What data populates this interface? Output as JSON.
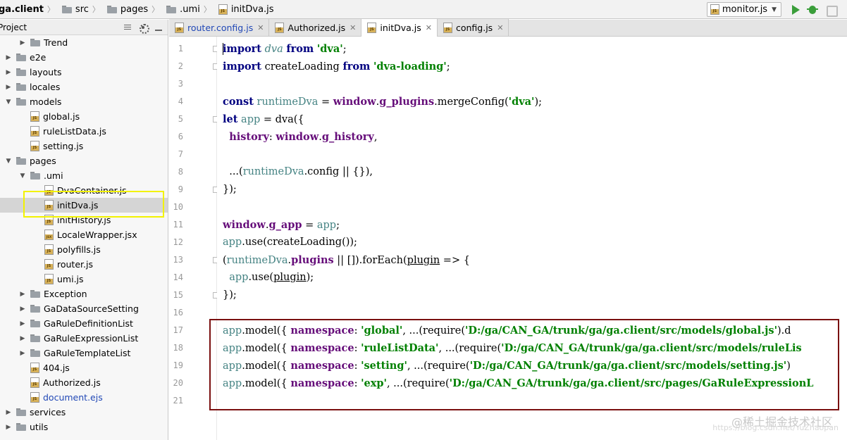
{
  "breadcrumb": [
    {
      "label": "ga.client",
      "icon": "folder-icon"
    },
    {
      "label": "src",
      "icon": "folder-icon"
    },
    {
      "label": "pages",
      "icon": "folder-icon"
    },
    {
      "label": ".umi",
      "icon": "folder-icon"
    },
    {
      "label": "initDva.js",
      "icon": "js-file-icon"
    }
  ],
  "run": {
    "config_label": "monitor.js"
  },
  "project_panel": {
    "title": "Project"
  },
  "tree": [
    {
      "label": "Trend",
      "type": "folder",
      "depth": 1,
      "arrow": "▶"
    },
    {
      "label": "e2e",
      "type": "folder",
      "depth": 0,
      "arrow": "▶"
    },
    {
      "label": "layouts",
      "type": "folder",
      "depth": 0,
      "arrow": "▶"
    },
    {
      "label": "locales",
      "type": "folder",
      "depth": 0,
      "arrow": "▶"
    },
    {
      "label": "models",
      "type": "folder",
      "depth": 0,
      "arrow": "▼"
    },
    {
      "label": "global.js",
      "type": "js",
      "depth": 1
    },
    {
      "label": "ruleListData.js",
      "type": "js",
      "depth": 1
    },
    {
      "label": "setting.js",
      "type": "js",
      "depth": 1
    },
    {
      "label": "pages",
      "type": "folder",
      "depth": 0,
      "arrow": "▼"
    },
    {
      "label": ".umi",
      "type": "folder",
      "depth": 1,
      "arrow": "▼"
    },
    {
      "label": "DvaContainer.js",
      "type": "js",
      "depth": 2
    },
    {
      "label": "initDva.js",
      "type": "js",
      "depth": 2,
      "selected": true
    },
    {
      "label": "initHistory.js",
      "type": "js",
      "depth": 2
    },
    {
      "label": "LocaleWrapper.jsx",
      "type": "jsx",
      "depth": 2
    },
    {
      "label": "polyfills.js",
      "type": "js",
      "depth": 2
    },
    {
      "label": "router.js",
      "type": "js",
      "depth": 2
    },
    {
      "label": "umi.js",
      "type": "js",
      "depth": 2
    },
    {
      "label": "Exception",
      "type": "folder",
      "depth": 1,
      "arrow": "▶"
    },
    {
      "label": "GaDataSourceSetting",
      "type": "folder",
      "depth": 1,
      "arrow": "▶"
    },
    {
      "label": "GaRuleDefinitionList",
      "type": "folder",
      "depth": 1,
      "arrow": "▶"
    },
    {
      "label": "GaRuleExpressionList",
      "type": "folder",
      "depth": 1,
      "arrow": "▶"
    },
    {
      "label": "GaRuleTemplateList",
      "type": "folder",
      "depth": 1,
      "arrow": "▶"
    },
    {
      "label": "404.js",
      "type": "js",
      "depth": 1
    },
    {
      "label": "Authorized.js",
      "type": "js",
      "depth": 1
    },
    {
      "label": "document.ejs",
      "type": "js",
      "depth": 1,
      "blue": true
    },
    {
      "label": "services",
      "type": "folder",
      "depth": 0,
      "arrow": "▶"
    },
    {
      "label": "utils",
      "type": "folder",
      "depth": 0,
      "arrow": "▶"
    }
  ],
  "tabs": [
    {
      "label": "router.config.js",
      "active": false,
      "blue": true
    },
    {
      "label": "Authorized.js",
      "active": false,
      "blue": false
    },
    {
      "label": "initDva.js",
      "active": true,
      "blue": false
    },
    {
      "label": "config.js",
      "active": false,
      "blue": false
    }
  ],
  "code_lines": [
    [
      [
        "kw",
        "import"
      ],
      [
        "",
        ""
      ],
      [
        " ",
        ""
      ],
      [
        "it",
        "dva"
      ],
      [
        " ",
        ""
      ],
      [
        "kw",
        "from"
      ],
      [
        " ",
        ""
      ],
      [
        "str",
        "'dva'"
      ],
      [
        "",
        ";"
      ]
    ],
    [
      [
        "kw",
        "import"
      ],
      [
        "",
        " createLoading "
      ],
      [
        "kw",
        "from"
      ],
      [
        " ",
        ""
      ],
      [
        "str",
        "'dva-loading'"
      ],
      [
        "",
        ";"
      ]
    ],
    [],
    [
      [
        "kw",
        "const"
      ],
      [
        " ",
        ""
      ],
      [
        "var",
        "runtimeDva"
      ],
      [
        "",
        " = "
      ],
      [
        "fld",
        "window"
      ],
      [
        "",
        "."
      ],
      [
        "fld",
        "g_plugins"
      ],
      [
        "",
        ".mergeConfig("
      ],
      [
        "str",
        "'dva'"
      ],
      [
        "",
        ");"
      ]
    ],
    [
      [
        "kw",
        "let"
      ],
      [
        " ",
        ""
      ],
      [
        "var",
        "app"
      ],
      [
        "",
        " = dva({"
      ]
    ],
    [
      [
        "",
        "  "
      ],
      [
        "fld",
        "history"
      ],
      [
        "",
        ": "
      ],
      [
        "fld",
        "window"
      ],
      [
        "",
        "."
      ],
      [
        "fld",
        "g_history"
      ],
      [
        "",
        ","
      ]
    ],
    [],
    [
      [
        "",
        "  ...("
      ],
      [
        "var",
        "runtimeDva"
      ],
      [
        "",
        ".config || {}),"
      ]
    ],
    [
      [
        "",
        "});"
      ]
    ],
    [],
    [
      [
        "fld",
        "window"
      ],
      [
        "",
        "."
      ],
      [
        "fld",
        "g_app"
      ],
      [
        "",
        " = "
      ],
      [
        "var",
        "app"
      ],
      [
        "",
        ";"
      ]
    ],
    [
      [
        "var",
        "app"
      ],
      [
        "",
        ".use(createLoading());"
      ]
    ],
    [
      [
        "",
        "("
      ],
      [
        "var",
        "runtimeDva"
      ],
      [
        "",
        "."
      ],
      [
        "fld",
        "plugins"
      ],
      [
        "",
        " || []).forEach("
      ],
      [
        "ul",
        "plugin"
      ],
      [
        "",
        " => {"
      ]
    ],
    [
      [
        "",
        "  "
      ],
      [
        "var",
        "app"
      ],
      [
        "",
        ".use("
      ],
      [
        "ul",
        "plugin"
      ],
      [
        "",
        ");"
      ]
    ],
    [
      [
        "",
        "});"
      ]
    ],
    [],
    [
      [
        "var",
        "app"
      ],
      [
        "",
        ".model({ "
      ],
      [
        "fld",
        "namespace"
      ],
      [
        "",
        ": "
      ],
      [
        "str",
        "'global'"
      ],
      [
        "",
        ", ...(require("
      ],
      [
        "str",
        "'D:/ga/CAN_GA/trunk/ga/ga.client/src/models/global.js'"
      ],
      [
        "",
        ").d"
      ]
    ],
    [
      [
        "var",
        "app"
      ],
      [
        "",
        ".model({ "
      ],
      [
        "fld",
        "namespace"
      ],
      [
        "",
        ": "
      ],
      [
        "str",
        "'ruleListData'"
      ],
      [
        "",
        ", ...(require("
      ],
      [
        "str",
        "'D:/ga/CAN_GA/trunk/ga/ga.client/src/models/ruleLis"
      ]
    ],
    [
      [
        "var",
        "app"
      ],
      [
        "",
        ".model({ "
      ],
      [
        "fld",
        "namespace"
      ],
      [
        "",
        ": "
      ],
      [
        "str",
        "'setting'"
      ],
      [
        "",
        ", ...(require("
      ],
      [
        "str",
        "'D:/ga/CAN_GA/trunk/ga/ga.client/src/models/setting.js'"
      ],
      [
        "",
        ")"
      ]
    ],
    [
      [
        "var",
        "app"
      ],
      [
        "",
        ".model({ "
      ],
      [
        "fld",
        "namespace"
      ],
      [
        "",
        ": "
      ],
      [
        "str",
        "'exp'"
      ],
      [
        "",
        ", ...(require("
      ],
      [
        "str",
        "'D:/ga/CAN_GA/trunk/ga/ga.client/src/pages/GaRuleExpressionL"
      ]
    ],
    []
  ],
  "line_numbers": [
    "1",
    "2",
    "3",
    "4",
    "5",
    "6",
    "7",
    "8",
    "9",
    "10",
    "11",
    "12",
    "13",
    "14",
    "15",
    "16",
    "17",
    "18",
    "19",
    "20",
    "21"
  ],
  "watermark": "@稀土掘金技术社区",
  "watermark_url": "https://blog.csdn.net/YuZhaopan"
}
